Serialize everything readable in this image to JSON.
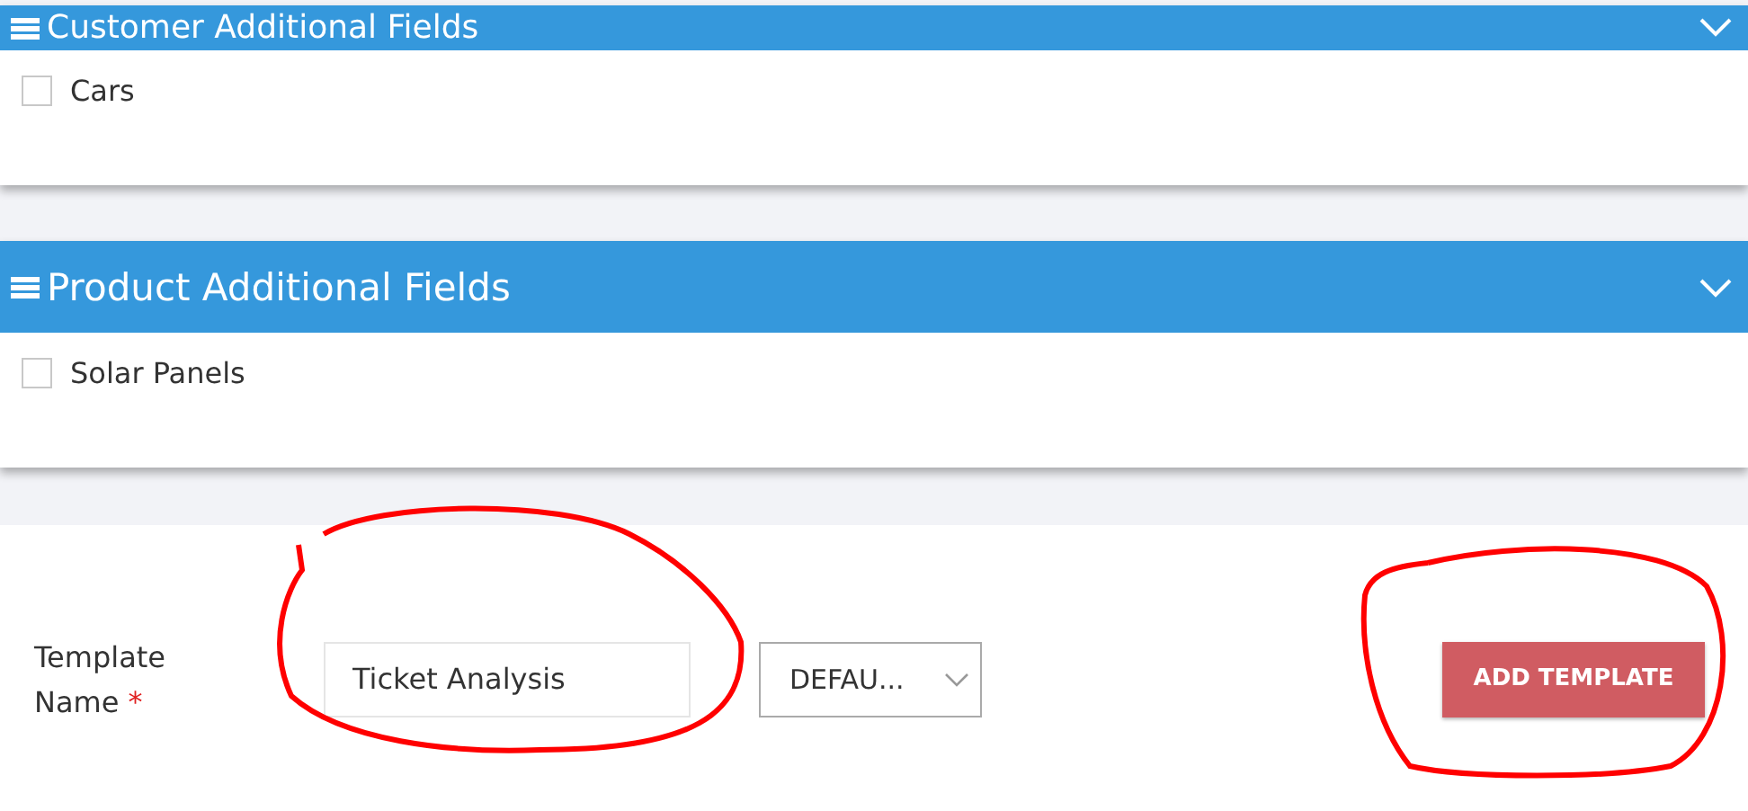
{
  "panels": [
    {
      "title": "Customer Additional Fields",
      "expanded": true,
      "fields": [
        {
          "label": "Cars",
          "checked": false
        }
      ]
    },
    {
      "title": "Product Additional Fields",
      "expanded": true,
      "fields": [
        {
          "label": "Solar Panels",
          "checked": false
        }
      ]
    }
  ],
  "template_form": {
    "label": "Template Name",
    "required_mark": "*",
    "name_value": "Ticket Analysis",
    "name_circled": true,
    "select_value": "DEFAU...",
    "button": "ADD TEMPLATE",
    "button_circled": true
  }
}
